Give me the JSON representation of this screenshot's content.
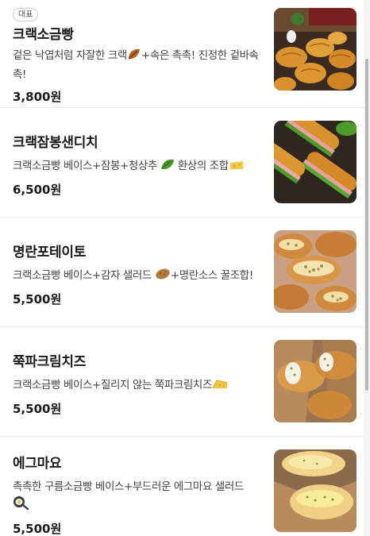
{
  "menu": {
    "items": [
      {
        "badge": "대표",
        "name": "크랙소금빵",
        "desc_parts": [
          "겉은 낙엽처럼 자잘한 크랙",
          "+속은 촉촉! 진정한 겉바속촉!"
        ],
        "emojis": [
          "leaf-icon"
        ],
        "price": "3,800원"
      },
      {
        "name": "크랙잠봉샌디치",
        "desc_parts": [
          "크랙소금빵 베이스+잠봉+청상추",
          " 환상의 조합"
        ],
        "emojis": [
          "lettuce-icon",
          "cheese-slice-icon"
        ],
        "price": "6,500원"
      },
      {
        "name": "명란포테이토",
        "desc_parts": [
          "크랙소금빵 베이스+감자 샐러드",
          "+명란소스 꿀조합!"
        ],
        "emojis": [
          "potato-icon"
        ],
        "price": "5,500원"
      },
      {
        "name": "쭉파크림치즈",
        "desc_parts": [
          "크랙소금빵 베이스+질리지 않는 쭉파크림치즈"
        ],
        "emojis": [
          "cheese-wedge-icon"
        ],
        "price": "5,500원"
      },
      {
        "name": "에그마요",
        "desc_parts": [
          "촉촉한 구름소금빵 베이스+부드러운 에그마요 샐러드"
        ],
        "emojis": [
          "frying-egg-icon"
        ],
        "price": "5,500원"
      }
    ]
  },
  "colors": {
    "bread": "#d9932e",
    "bread_dark": "#a85f17",
    "ham": "#e8a0a0",
    "lettuce": "#4c9a2a",
    "paper": "#b88a5c"
  }
}
